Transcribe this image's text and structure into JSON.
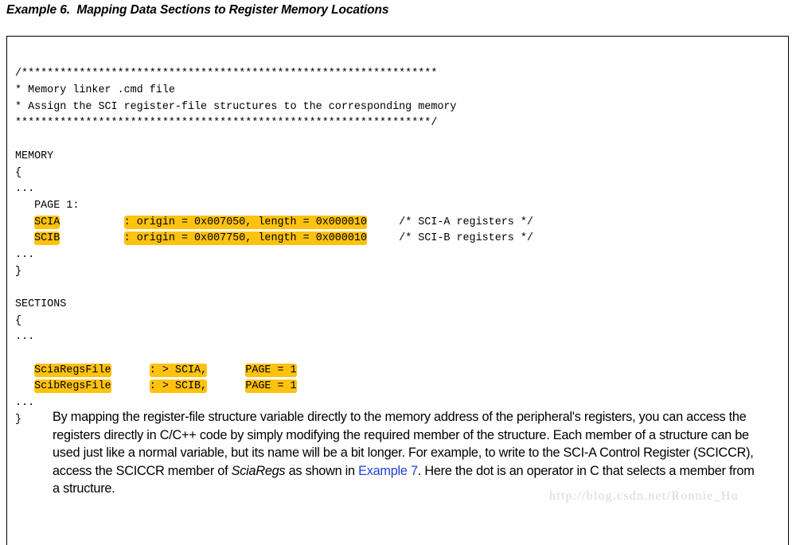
{
  "title": "Example 6.  Mapping Data Sections to Register Memory Locations",
  "code": {
    "lines": [
      {
        "id": "comment-open",
        "segments": [
          {
            "text": "/*****************************************************************",
            "highlight": false
          }
        ]
      },
      {
        "id": "comment-1",
        "segments": [
          {
            "text": "* Memory linker .cmd file",
            "highlight": false
          }
        ]
      },
      {
        "id": "comment-2",
        "segments": [
          {
            "text": "* Assign the SCI register-file structures to the corresponding memory",
            "highlight": false
          }
        ]
      },
      {
        "id": "comment-close",
        "segments": [
          {
            "text": "*****************************************************************/",
            "highlight": false
          }
        ]
      },
      {
        "id": "blank-1",
        "segments": [
          {
            "text": " ",
            "highlight": false
          }
        ]
      },
      {
        "id": "memory-kw",
        "segments": [
          {
            "text": "MEMORY",
            "highlight": false
          }
        ]
      },
      {
        "id": "memory-open",
        "segments": [
          {
            "text": "{",
            "highlight": false
          }
        ]
      },
      {
        "id": "memory-ellipsis",
        "segments": [
          {
            "text": "...",
            "highlight": false
          }
        ]
      },
      {
        "id": "page-1",
        "segments": [
          {
            "text": "   PAGE 1:",
            "highlight": false
          }
        ]
      },
      {
        "id": "scia-row",
        "segments": [
          {
            "text": "   ",
            "highlight": false
          },
          {
            "text": "SCIA",
            "highlight": true
          },
          {
            "text": "          ",
            "highlight": false
          },
          {
            "text": ": origin = 0x007050, length = 0x000010",
            "highlight": true
          },
          {
            "text": "     /* SCI-A registers */",
            "highlight": false
          }
        ]
      },
      {
        "id": "scib-row",
        "segments": [
          {
            "text": "   ",
            "highlight": false
          },
          {
            "text": "SCIB",
            "highlight": true
          },
          {
            "text": "          ",
            "highlight": false
          },
          {
            "text": ": origin = 0x007750, length = 0x000010",
            "highlight": true
          },
          {
            "text": "     /* SCI-B registers */",
            "highlight": false
          }
        ]
      },
      {
        "id": "memory-ellipsis-2",
        "segments": [
          {
            "text": "...",
            "highlight": false
          }
        ]
      },
      {
        "id": "memory-close",
        "segments": [
          {
            "text": "}",
            "highlight": false
          }
        ]
      },
      {
        "id": "blank-2",
        "segments": [
          {
            "text": " ",
            "highlight": false
          }
        ]
      },
      {
        "id": "sections-kw",
        "segments": [
          {
            "text": "SECTIONS",
            "highlight": false
          }
        ]
      },
      {
        "id": "sections-open",
        "segments": [
          {
            "text": "{",
            "highlight": false
          }
        ]
      },
      {
        "id": "sections-ellipsis",
        "segments": [
          {
            "text": "...",
            "highlight": false
          }
        ]
      },
      {
        "id": "blank-3",
        "segments": [
          {
            "text": " ",
            "highlight": false
          }
        ]
      },
      {
        "id": "sciaregsfile-row",
        "segments": [
          {
            "text": "   ",
            "highlight": false
          },
          {
            "text": "SciaRegsFile",
            "highlight": true
          },
          {
            "text": "      ",
            "highlight": false
          },
          {
            "text": ": > SCIA,",
            "highlight": true
          },
          {
            "text": "      ",
            "highlight": false
          },
          {
            "text": "PAGE = 1",
            "highlight": true
          }
        ]
      },
      {
        "id": "scibregsfile-row",
        "segments": [
          {
            "text": "   ",
            "highlight": false
          },
          {
            "text": "ScibRegsFile",
            "highlight": true
          },
          {
            "text": "      ",
            "highlight": false
          },
          {
            "text": ": > SCIB,",
            "highlight": true
          },
          {
            "text": "      ",
            "highlight": false
          },
          {
            "text": "PAGE = 1",
            "highlight": true
          }
        ]
      },
      {
        "id": "sections-ellipsis-2",
        "segments": [
          {
            "text": "...",
            "highlight": false
          }
        ]
      },
      {
        "id": "sections-close",
        "segments": [
          {
            "text": "}",
            "highlight": false
          }
        ]
      }
    ],
    "highlight_color": "#FFC20E"
  },
  "explanation": {
    "part_1": "By mapping the register-file structure variable directly to the memory address of the peripheral's registers, you can access the registers directly in C/C++ code by simply modifying the required member of the structure. Each member of a structure can be used just like a normal variable, but its name will be a bit longer. For example, to write to the SCI-A Control Register (SCICCR), access the SCICCR member of ",
    "italic_term": "SciaRegs",
    "part_2": " as shown in ",
    "link_label": "Example 7",
    "part_3": ". Here the dot is an operator in C that selects a member from a structure.",
    "link_color": "#1d3fd4"
  },
  "watermark": "http://blog.csdn.net/Ronnie_Hu"
}
